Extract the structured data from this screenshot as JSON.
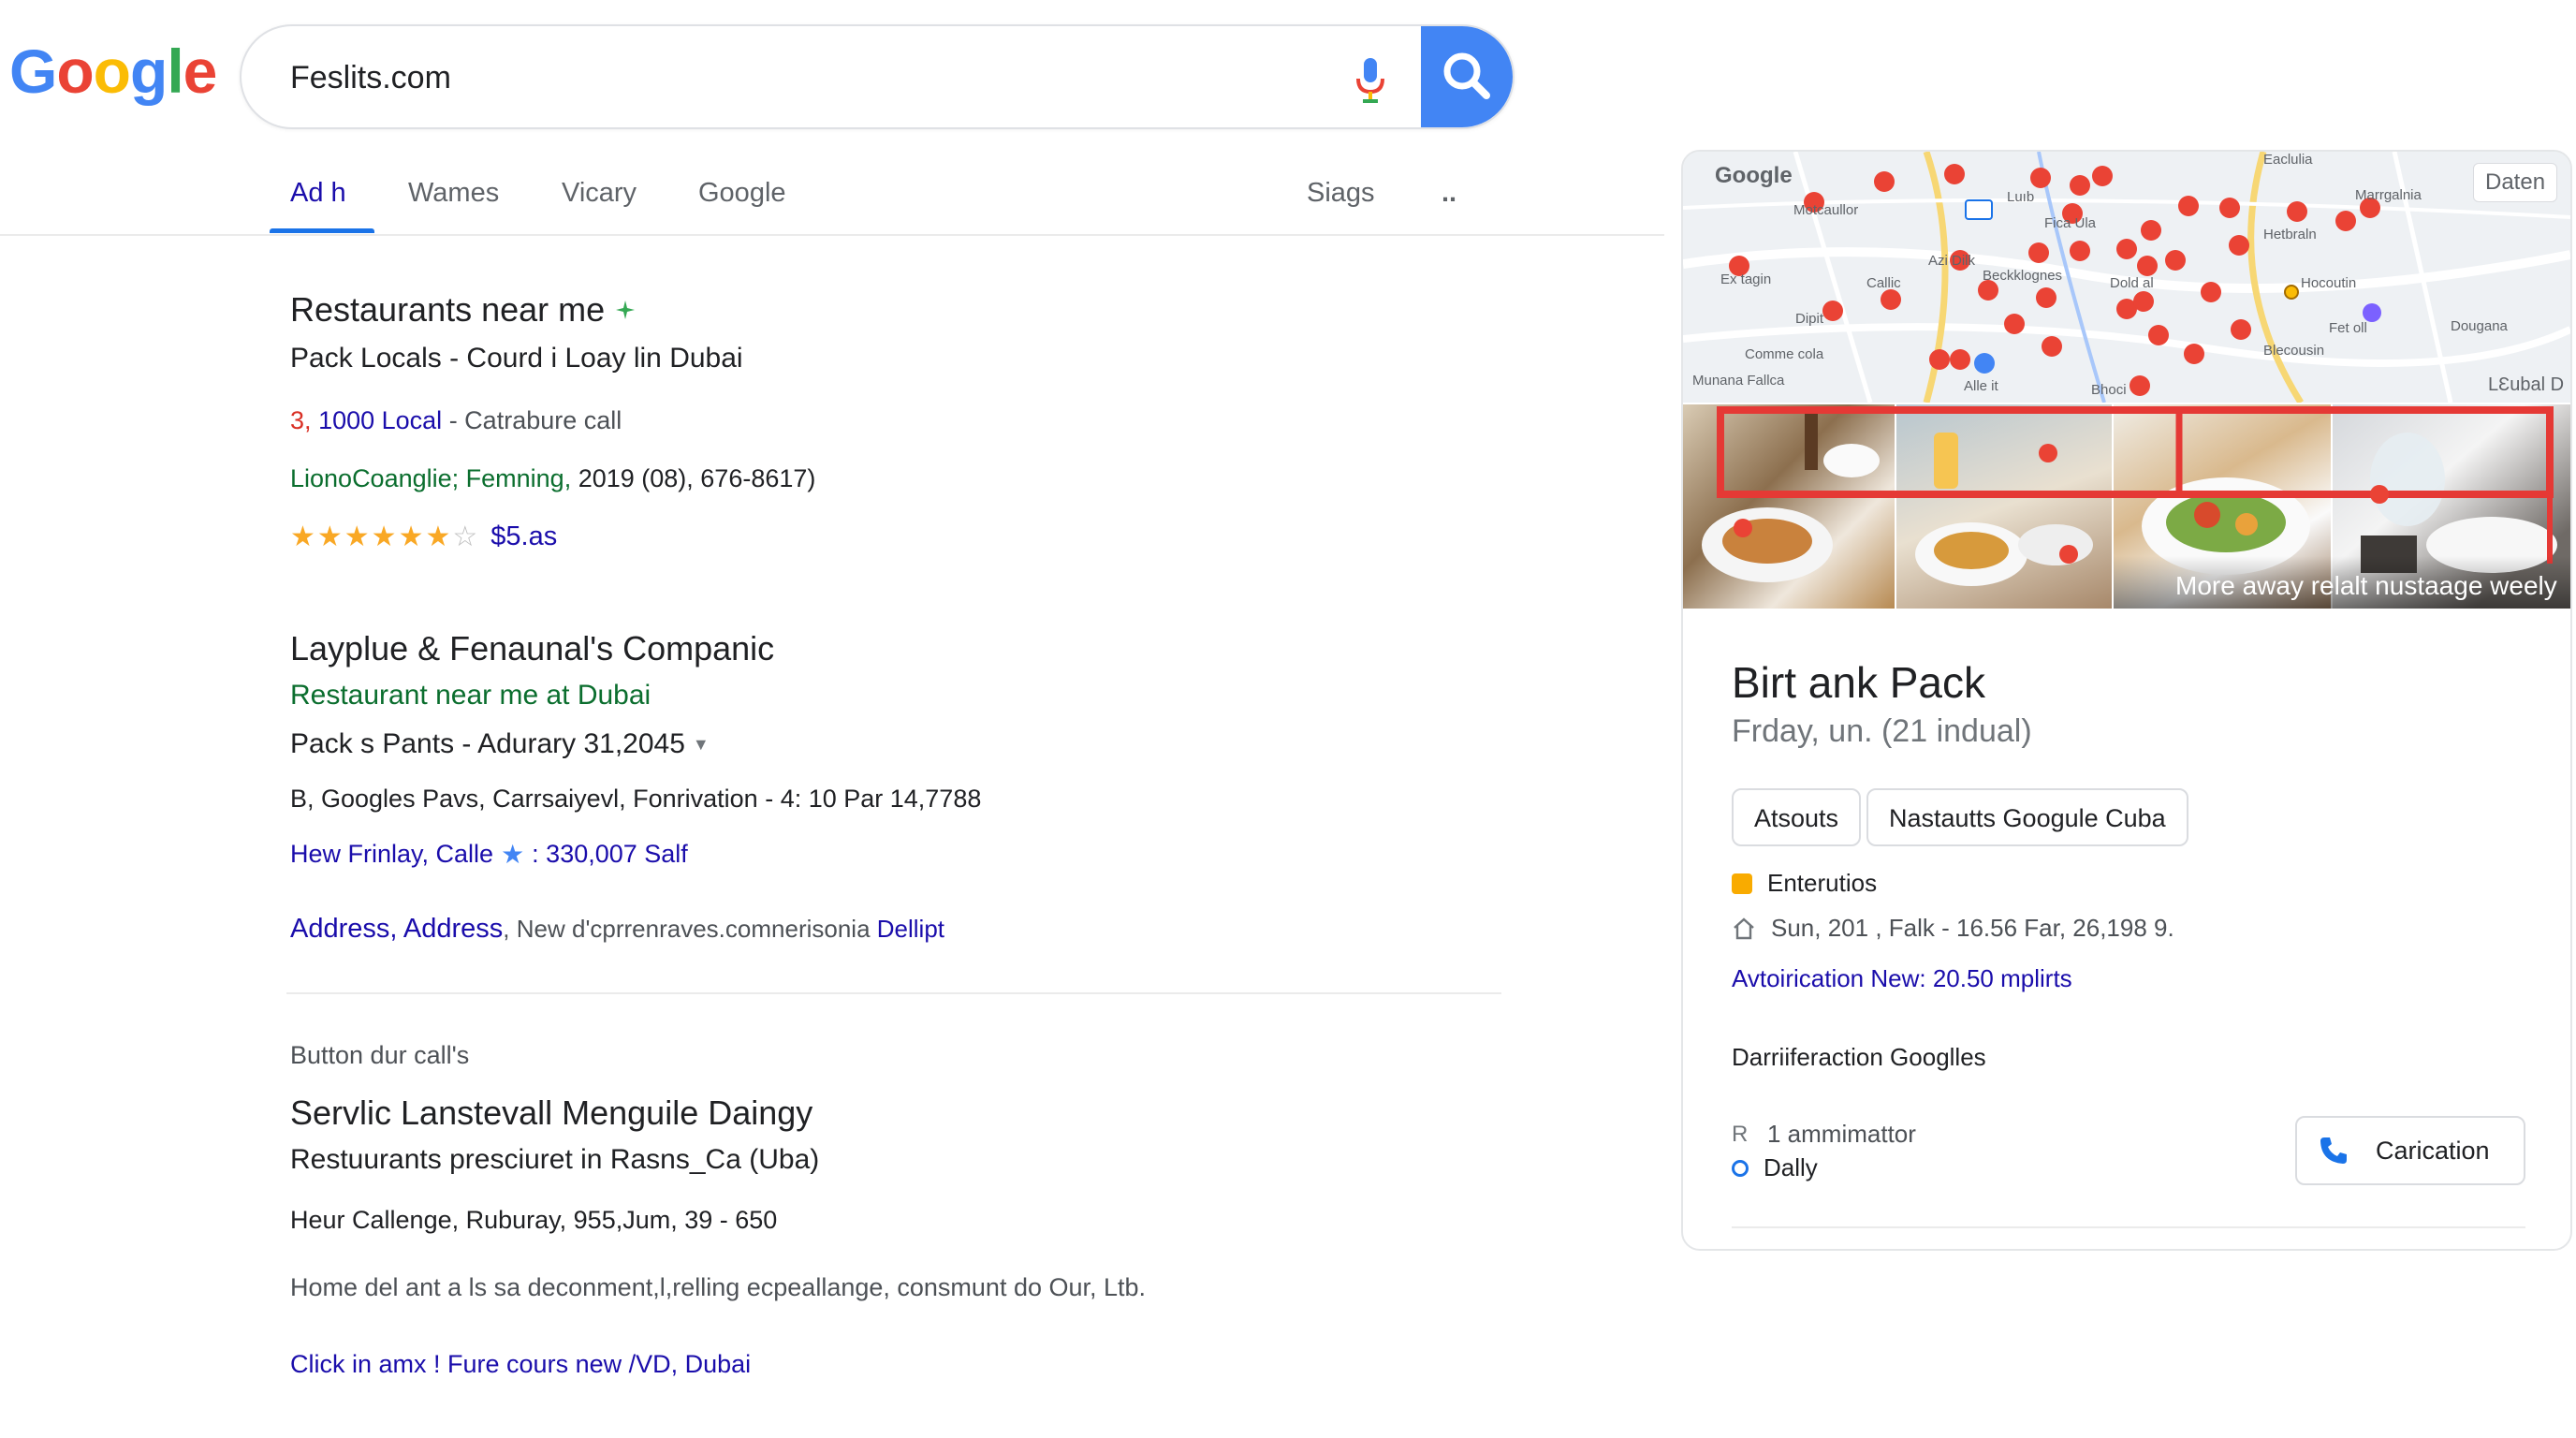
{
  "search": {
    "query": "Feslits.com"
  },
  "tabs": [
    {
      "label": "Ad h"
    },
    {
      "label": "Wames"
    },
    {
      "label": "Vicary"
    },
    {
      "label": "Google"
    },
    {
      "label": "Siags"
    },
    {
      "label": ".."
    }
  ],
  "results": [
    {
      "title": "Restaurants near me",
      "subtitle": "Pack Locals - Courd i Loay lin Dubai",
      "meta_num": "3",
      "meta_link": "1000 Local",
      "meta_rest": " - Catrabure call",
      "info_green": "LionoCoanglie; Femning,",
      "info_rest": " 2019 (08), 676-8617)",
      "rating_price": "$5.as"
    },
    {
      "title": "Layplue & Fenaunal's Companic",
      "subtitle_green": "Restaurant near me at Dubai",
      "line_a": "Pack s Pants - Adurary 31,2045",
      "line_b": "B, Googles Pavs, Carrsaiyevl, Fonrivation - 4: 10 Par 14,7788",
      "line_c1": "Hew Frinlay, Calle",
      "line_c2": ": 330,007 Salf",
      "line_d_link": "Address, Address",
      "line_d_mid": ", New d'cprrenraves.comnerisonia ",
      "line_d_link2": "Dellipt"
    },
    {
      "label": "Button dur call's",
      "title": "Servlic Lanstevall Menguile Daingy",
      "subtitle": "Restuurants presciuret in Rasns_Ca (Uba)",
      "line_a": "Heur Callenge, Ruburay, 955,Jum, 39 - 650",
      "line_b": "Home del ant a ls sa deconment,l,relling ecpeallange, consmunt do Our, Ltb.",
      "line_c": "Click in amx ! Fure cours new /VD, Dubai"
    }
  ],
  "panel": {
    "map_brand": "Google",
    "map_button": "Daten",
    "map_corner": "LƐubal D",
    "map_labels": [
      "Eaclulia",
      "Marrgalnia",
      "Motcaullor",
      "Luıb",
      "Fica Ula",
      "Hetbraln",
      "Ex tagin",
      "Callic",
      "Beckklognes",
      "Dold al",
      "Hocoutin",
      "Fet oll",
      "Dougana",
      "Blecousin",
      "Comme cola",
      "Munana Fallca",
      "Alle it",
      "Bhoci",
      "Dipit",
      "Azi Dilk"
    ],
    "photo_caption": "More away relalt nustaage weely",
    "title": "Birt ank Pack",
    "subtitle": "Frday, un. (21 indual)",
    "chips": [
      "Atsouts",
      "Nastautts Googule Cuba"
    ],
    "row1": "Enterutios",
    "row2": "Sun, 201 , Falk - 16.56 Far, 26,198 9.",
    "row3": "Avtoirication New: 20.50 mplirts",
    "row4": "Darriiferaction Googlles",
    "row5": "1 ammimattor",
    "row6": "Dally",
    "call_label": "Carication"
  }
}
